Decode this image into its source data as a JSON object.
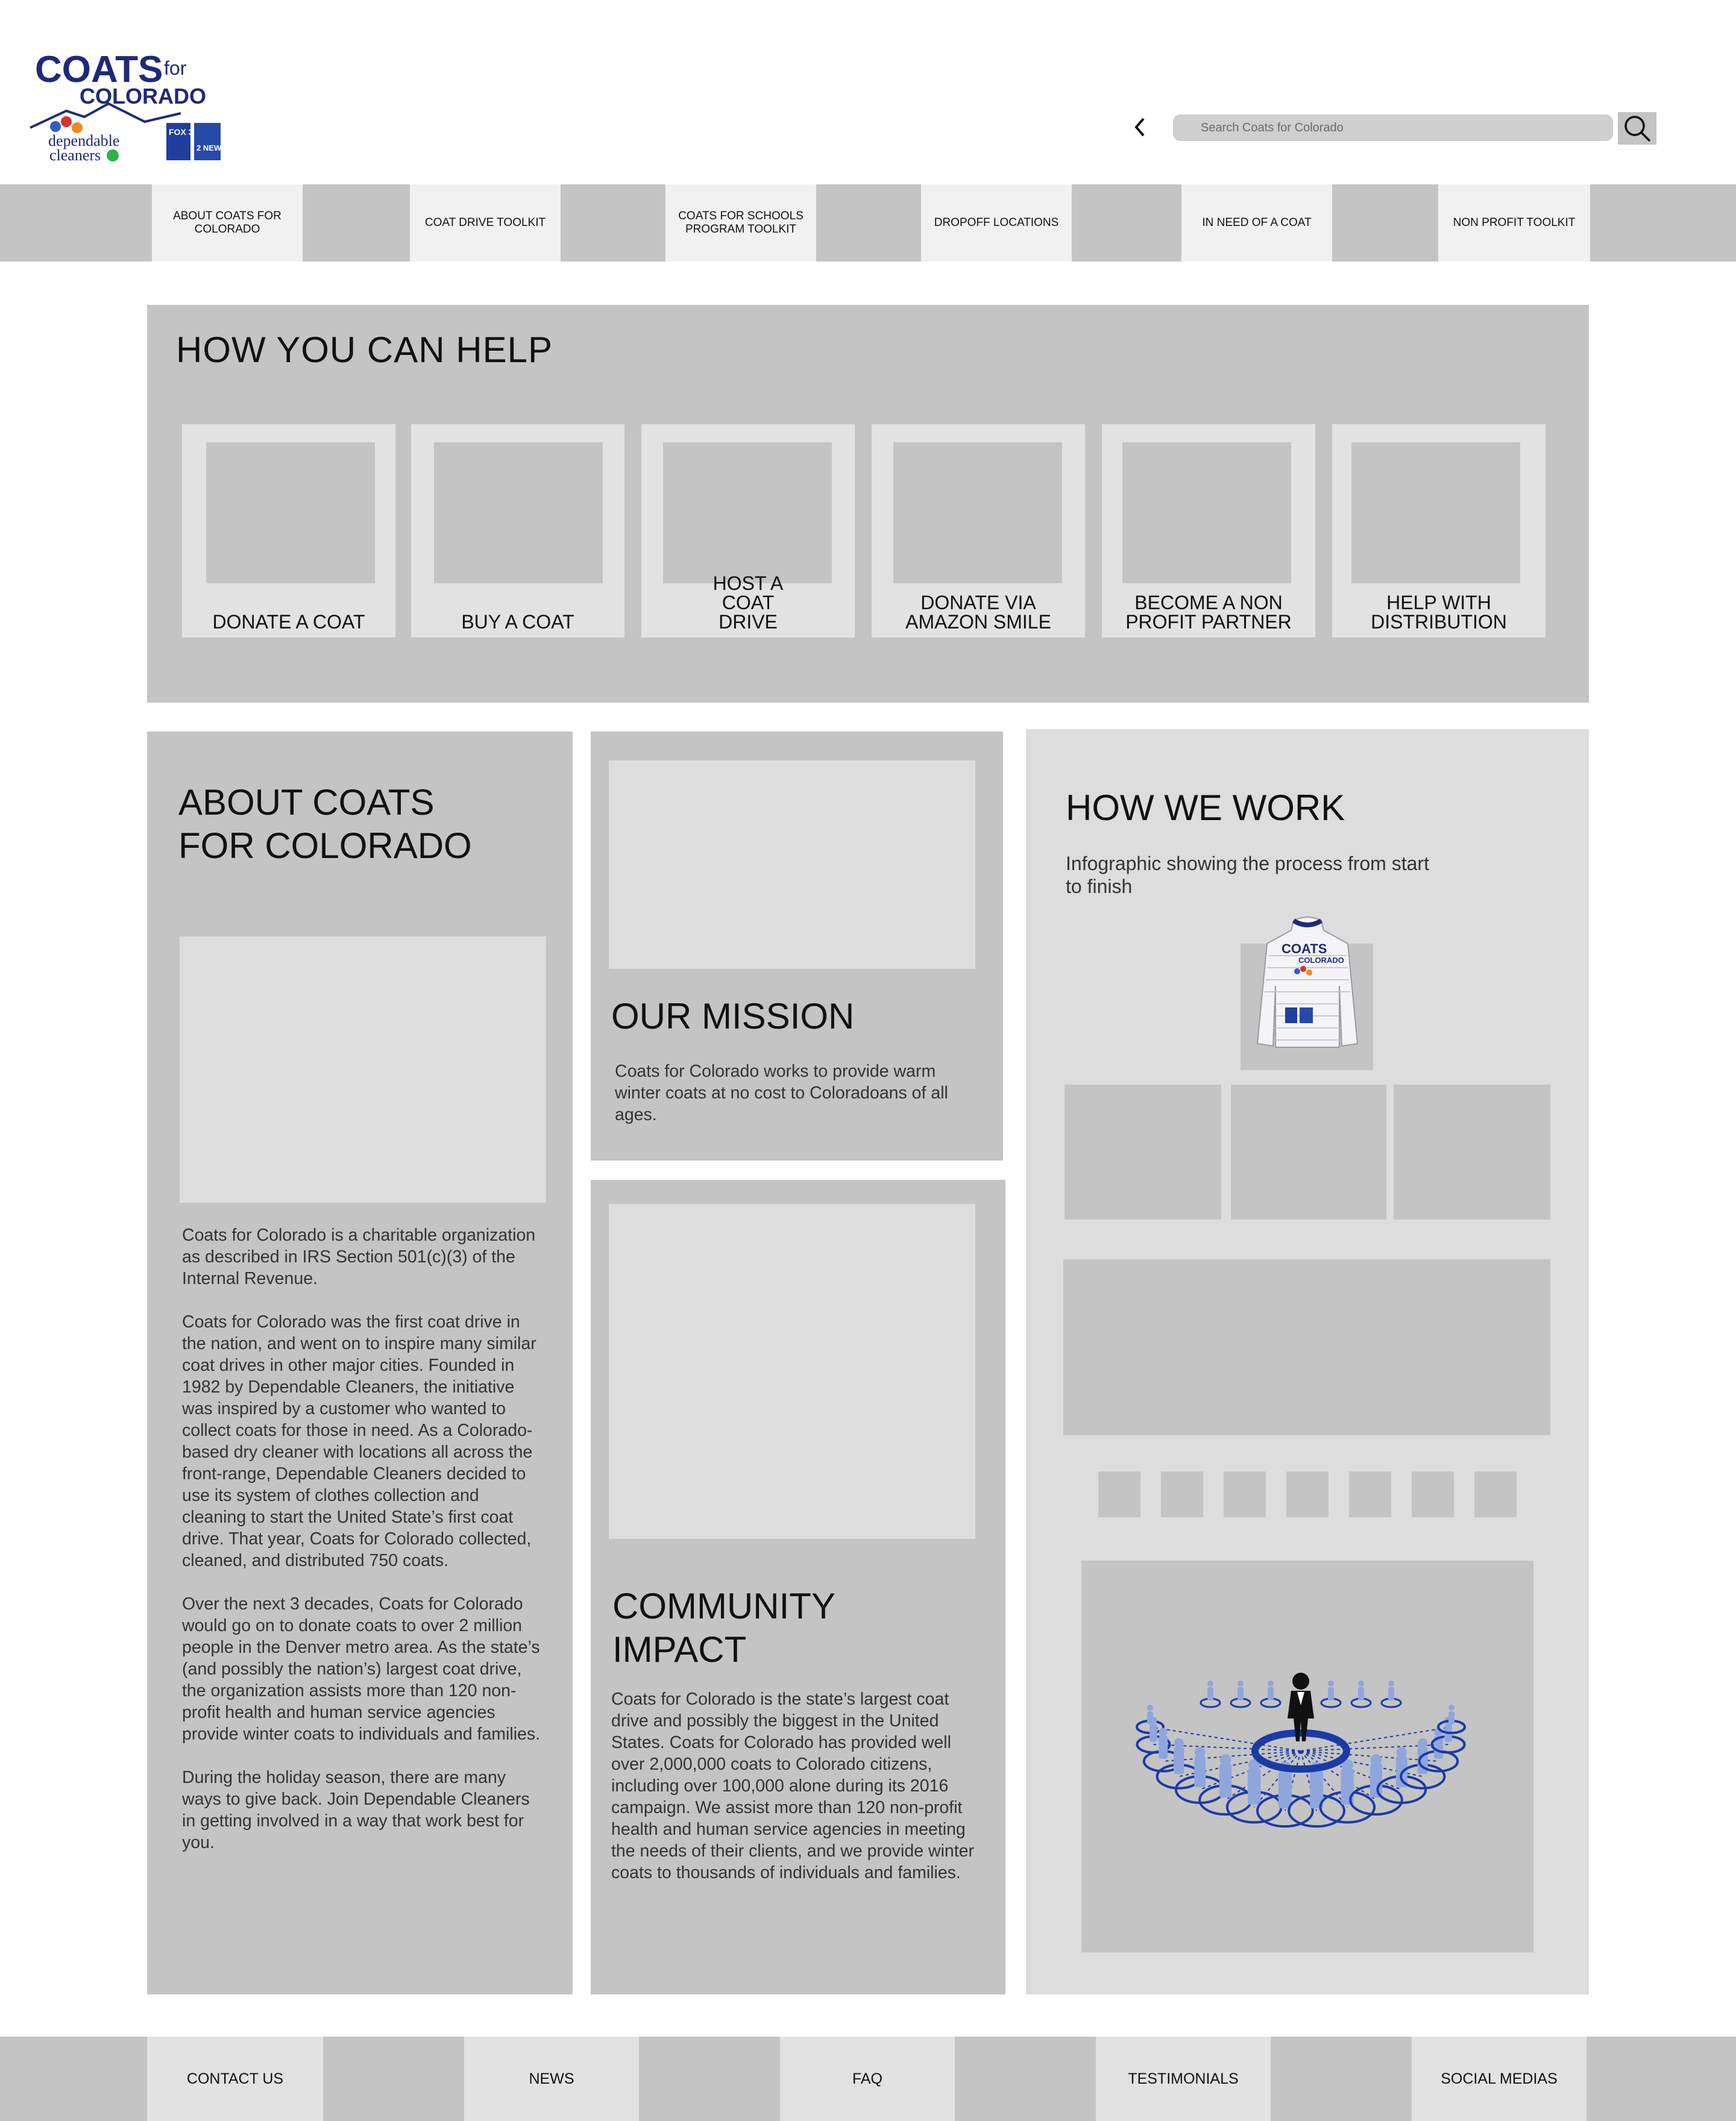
{
  "header": {
    "logo": {
      "text_main": "COATS",
      "text_for": "for",
      "text_state": "COLORADO",
      "partner1": "dependable",
      "partner2": "cleaners",
      "media1": "FOX 31",
      "media2": "2 NEWS"
    },
    "back_icon": "chevron-left-icon",
    "search": {
      "placeholder": "Search Coats for Colorado",
      "icon": "search-icon"
    }
  },
  "nav": {
    "items": [
      {
        "label": "ABOUT COATS FOR COLORADO"
      },
      {
        "label": "COAT DRIVE TOOLKIT"
      },
      {
        "label": "COATS FOR SCHOOLS PROGRAM TOOLKIT"
      },
      {
        "label": "DROPOFF LOCATIONS"
      },
      {
        "label": "IN NEED OF A COAT"
      },
      {
        "label": "NON PROFIT TOOLKIT"
      }
    ]
  },
  "help": {
    "title": "HOW YOU CAN HELP",
    "cards": [
      {
        "label": "DONATE A COAT"
      },
      {
        "label": "BUY A COAT"
      },
      {
        "label": "HOST A COAT DRIVE"
      },
      {
        "label": "DONATE VIA AMAZON SMILE"
      },
      {
        "label": "BECOME A NON PROFIT PARTNER"
      },
      {
        "label": "HELP WITH DISTRIBUTION"
      }
    ]
  },
  "about": {
    "title": "ABOUT COATS FOR COLORADO",
    "text": "Coats for Colorado is a charitable organization as described in IRS Section 501(c)(3) of the Internal Revenue.\n\nCoats for Colorado was the first coat drive in the nation, and went on to inspire many similar coat drives in other major cities. Founded in 1982 by Dependable Cleaners, the initiative was inspired by a customer who wanted to collect coats for those in need. As a Colorado-based dry cleaner with locations all across the front-range, Dependable Cleaners decided to use its system of clothes collection and cleaning to start the United State’s first coat drive. That year, Coats for Colorado collected, cleaned, and distributed 750 coats.\n\nOver the next 3 decades, Coats for Colorado would go on to donate coats to over 2 million people in the Denver metro area. As the state’s (and possibly the nation’s) largest coat drive, the organization assists more than 120 non-profit health and human service agencies provide winter coats to individuals and families.\n\nDuring the holiday season, there are many ways to give back. Join Dependable Cleaners in getting involved in a way that work best for you."
  },
  "mission": {
    "title": "OUR MISSION",
    "text": "Coats for Colorado works to provide warm winter coats at no cost to Coloradoans of all ages."
  },
  "impact": {
    "title": "COMMUNITY IMPACT",
    "text": "Coats for Colorado is the state’s largest coat drive and possibly the biggest in the United States. Coats for Colorado has provided well over 2,000,000 coats to Colorado citizens, including over 100,000 alone during its 2016 campaign. We assist more than 120 non-profit health and human service agencies in meeting the needs of their clients, and we provide winter coats to thousands of individuals and families."
  },
  "how_we_work": {
    "title": "HOW WE WORK",
    "subtitle": "Infographic showing the process from start to finish",
    "jacket_logo_line1": "COATS",
    "jacket_logo_line2": "COLORADO"
  },
  "footer": {
    "items": [
      {
        "label": "CONTACT US"
      },
      {
        "label": "NEWS"
      },
      {
        "label": "FAQ"
      },
      {
        "label": "TESTIMONIALS"
      },
      {
        "label": "SOCIAL MEDIAS"
      }
    ]
  },
  "colors": {
    "panel_gray": "#c4c4c4",
    "light_gray": "#dddddd",
    "nav_tab": "#f1f1f1",
    "brand_navy": "#1e2a78",
    "network_blue": "#1a3aa8",
    "people_blue": "#8fa6dd"
  }
}
